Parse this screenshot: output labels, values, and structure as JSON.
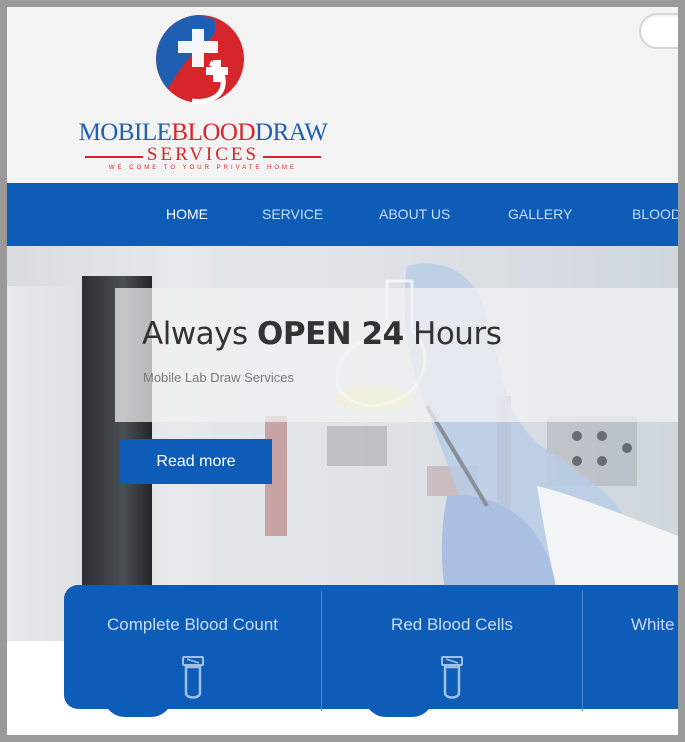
{
  "logo": {
    "title_part1": "MOBILE",
    "title_part2": "BLOOD",
    "title_part3": "DRAW",
    "subtitle": "SERVICES",
    "tagline": "WE COME TO YOUR PRIVATE HOME",
    "colors": {
      "blue": "#1f5fb3",
      "red": "#d6262b"
    }
  },
  "nav": {
    "items": [
      {
        "label": "HOME",
        "active": true
      },
      {
        "label": "SERVICE",
        "active": false
      },
      {
        "label": "ABOUT US",
        "active": false
      },
      {
        "label": "GALLERY",
        "active": false
      },
      {
        "label": "BLOOD",
        "active": false
      }
    ],
    "color": "#0d5cb7"
  },
  "hero": {
    "title_pre": "Always ",
    "title_bold": "OPEN 24",
    "title_post": " Hours",
    "subtitle": "Mobile Lab Draw Services",
    "button_label": "Read more"
  },
  "services": {
    "items": [
      {
        "label": "Complete Blood Count",
        "icon": "test-tube-icon"
      },
      {
        "label": "Red Blood Cells",
        "icon": "test-tube-icon"
      },
      {
        "label": "White",
        "icon": "test-tube-icon"
      }
    ]
  }
}
